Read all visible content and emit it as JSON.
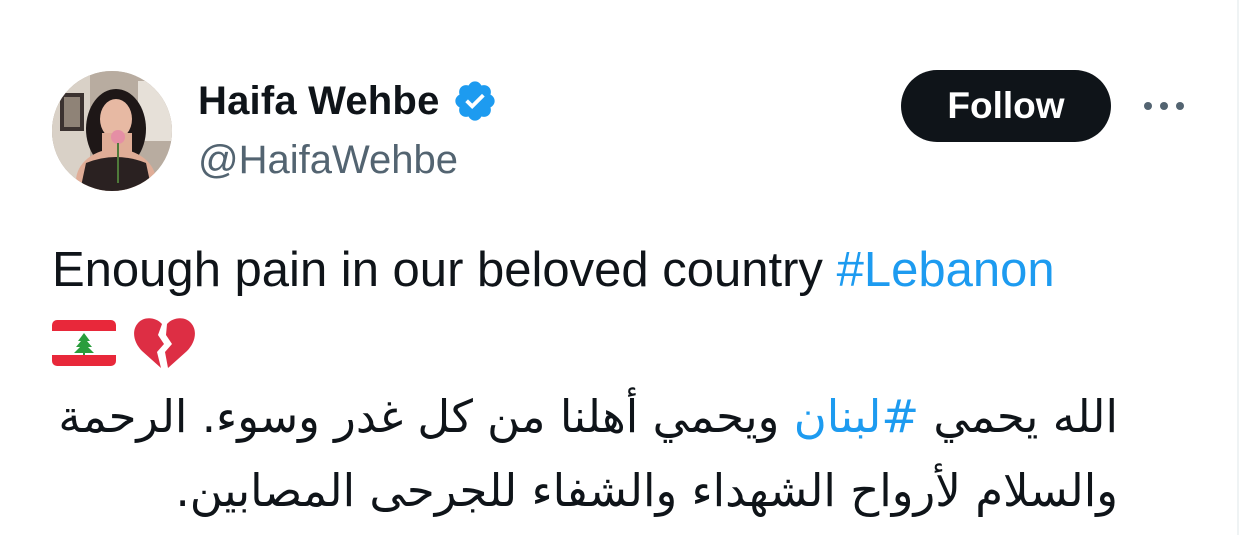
{
  "tweet": {
    "author": {
      "display_name": "Haifa Wehbe",
      "handle": "@HaifaWehbe",
      "verified_icon": "verified-badge-icon"
    },
    "follow_label": "Follow",
    "more_icon": "more-options-icon",
    "text_en_prefix": "Enough pain in our beloved country ",
    "text_en_hashtag": "#Lebanon",
    "emojis": [
      "lebanon-flag-emoji",
      "broken-heart-emoji"
    ],
    "text_ar_part1": "الله يحمي ",
    "text_ar_hashtag": "#لبنان",
    "text_ar_part2": " ويحمي أهلنا من كل غدر وسوء. الرحمة والسلام لأرواح الشهداء والشفاء للجرحى المصابين.",
    "colors": {
      "text_primary": "#0f1419",
      "text_secondary": "#536471",
      "link": "#1d9bf0",
      "verified": "#1d9bf0",
      "follow_bg": "#0f1419"
    }
  }
}
